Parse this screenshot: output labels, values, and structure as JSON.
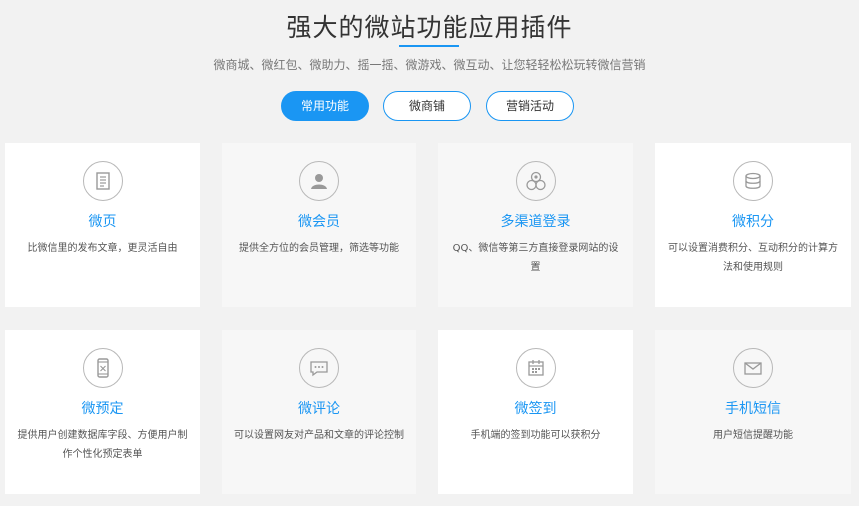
{
  "header": {
    "title": "强大的微站功能应用插件",
    "subtitle": "微商城、微红包、微助力、摇一摇、微游戏、微互动、让您轻轻松松玩转微信营销"
  },
  "tabs": [
    {
      "label": "常用功能",
      "active": true
    },
    {
      "label": "微商铺",
      "active": false
    },
    {
      "label": "营销活动",
      "active": false
    }
  ],
  "colors": {
    "accent": "#1a96f3",
    "background": "#f2f2f2"
  },
  "features": [
    {
      "icon": "document-icon",
      "title": "微页",
      "desc": "比微信里的发布文章，更灵活自由"
    },
    {
      "icon": "user-icon",
      "title": "微会员",
      "desc": "提供全方位的会员管理，筛选等功能"
    },
    {
      "icon": "multi-channel-icon",
      "title": "多渠道登录",
      "desc": "QQ、微信等第三方直接登录网站的设置"
    },
    {
      "icon": "coins-icon",
      "title": "微积分",
      "desc": "可以设置消费积分、互动积分的计算方法和使用规则"
    },
    {
      "icon": "phone-icon",
      "title": "微预定",
      "desc": "提供用户创建数据库字段、方便用户制作个性化预定表单"
    },
    {
      "icon": "chat-icon",
      "title": "微评论",
      "desc": "可以设置网友对产品和文章的评论控制"
    },
    {
      "icon": "calendar-icon",
      "title": "微签到",
      "desc": "手机端的签到功能可以获积分"
    },
    {
      "icon": "envelope-icon",
      "title": "手机短信",
      "desc": "用户短信提醒功能"
    }
  ]
}
